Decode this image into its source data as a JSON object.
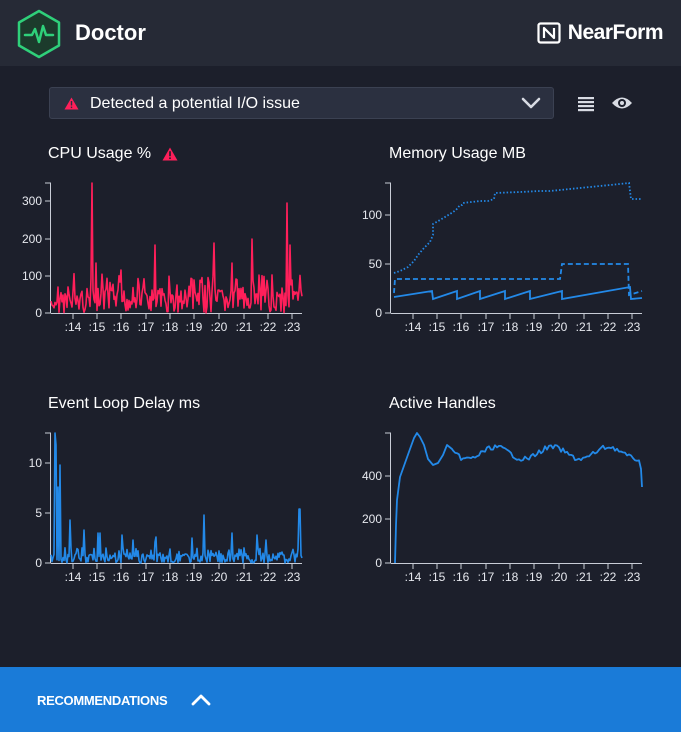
{
  "header": {
    "title": "Doctor",
    "brand": "NearForm",
    "logo_icon": "heartbeat-hexagon-icon",
    "brand_icon": "nearform-n-icon"
  },
  "alert": {
    "text": "Detected a potential I/O issue",
    "icon": "warning-triangle-icon",
    "toggle_icon": "chevron-down-icon"
  },
  "toolbar": {
    "list_icon": "list-view-icon",
    "eye_icon": "eye-icon"
  },
  "colors": {
    "background": "#1c1f2b",
    "header": "#262a36",
    "accent_red": "#ff1f5a",
    "accent_blue": "#2389e8",
    "footer": "#1a7bd8"
  },
  "x_ticks": [
    ":14",
    ":15",
    ":16",
    ":17",
    ":18",
    ":19",
    ":20",
    ":21",
    ":22",
    ":23"
  ],
  "charts": {
    "cpu": {
      "title": "CPU Usage %",
      "warning": true,
      "y_ticks": [
        "300",
        "200",
        "100",
        "0"
      ]
    },
    "memory": {
      "title": "Memory Usage MB",
      "y_ticks": [
        "100",
        "50",
        "0"
      ]
    },
    "eventloop": {
      "title": "Event Loop Delay ms",
      "y_ticks": [
        "10",
        "5",
        "0"
      ]
    },
    "handles": {
      "title": "Active Handles",
      "y_ticks": [
        "400",
        "200",
        "0"
      ]
    }
  },
  "footer": {
    "label": "RECOMMENDATIONS",
    "icon": "chevron-up-icon"
  }
}
